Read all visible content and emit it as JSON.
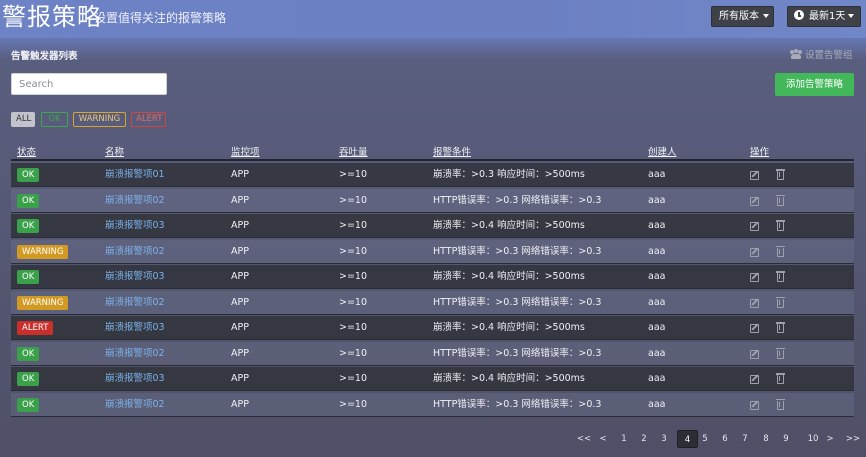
{
  "header": {
    "title": "警报策略",
    "subtitle": "设置值得关注的报警策略",
    "version_label": "所有版本",
    "time_label": "最新1天"
  },
  "panel": {
    "title": "告警触发器列表",
    "group_link": "设置告警组",
    "search_placeholder": "Search",
    "add_button": "添加告警策略"
  },
  "filters": {
    "all": "ALL",
    "ok": "OK",
    "warning": "WARNING",
    "alert": "ALERT"
  },
  "table": {
    "columns": [
      "状态",
      "名称",
      "监控项",
      "吞吐量",
      "报警条件",
      "创建人",
      "操作"
    ],
    "rows": [
      {
        "status": "OK",
        "name": "崩溃报警项01",
        "item": "APP",
        "throughput": ">=10",
        "condition": "崩溃率：>0.3   响应时间：>500ms",
        "creator": "aaa"
      },
      {
        "status": "OK",
        "name": "崩溃报警项02",
        "item": "APP",
        "throughput": ">=10",
        "condition": "HTTP错误率：>0.3   网络错误率：>0.3",
        "creator": "aaa"
      },
      {
        "status": "OK",
        "name": "崩溃报警项03",
        "item": "APP",
        "throughput": ">=10",
        "condition": "崩溃率：>0.4   响应时间：>500ms",
        "creator": "aaa"
      },
      {
        "status": "WARNING",
        "name": "崩溃报警项02",
        "item": "APP",
        "throughput": ">=10",
        "condition": "HTTP错误率：>0.3   网络错误率：>0.3",
        "creator": "aaa"
      },
      {
        "status": "OK",
        "name": "崩溃报警项03",
        "item": "APP",
        "throughput": ">=10",
        "condition": "崩溃率：>0.4   响应时间：>500ms",
        "creator": "aaa"
      },
      {
        "status": "WARNING",
        "name": "崩溃报警项02",
        "item": "APP",
        "throughput": ">=10",
        "condition": "HTTP错误率：>0.3   网络错误率：>0.3",
        "creator": "aaa"
      },
      {
        "status": "ALERT",
        "name": "崩溃报警项03",
        "item": "APP",
        "throughput": ">=10",
        "condition": "崩溃率：>0.4   响应时间：>500ms",
        "creator": "aaa"
      },
      {
        "status": "OK",
        "name": "崩溃报警项02",
        "item": "APP",
        "throughput": ">=10",
        "condition": "HTTP错误率：>0.3   网络错误率：>0.3",
        "creator": "aaa"
      },
      {
        "status": "OK",
        "name": "崩溃报警项03",
        "item": "APP",
        "throughput": ">=10",
        "condition": "崩溃率：>0.4   响应时间：>500ms",
        "creator": "aaa"
      },
      {
        "status": "OK",
        "name": "崩溃报警项02",
        "item": "APP",
        "throughput": ">=10",
        "condition": "HTTP错误率：>0.3   网络错误率：>0.3",
        "creator": "aaa"
      }
    ]
  },
  "pagination": {
    "items": [
      "<<",
      "<",
      "1",
      "2",
      "3",
      "4",
      "5",
      "6",
      "7",
      "8",
      "9",
      "10",
      ">",
      ">>"
    ],
    "active": "4"
  },
  "colors": {
    "ok": "#3aa14a",
    "warning": "#d29a22",
    "alert": "#c9302c",
    "add_button": "#43b85b",
    "link": "#7cb2ea"
  },
  "icons": {
    "clock": "clock-icon",
    "group": "group-icon",
    "edit": "edit-icon",
    "delete": "trash-icon"
  }
}
